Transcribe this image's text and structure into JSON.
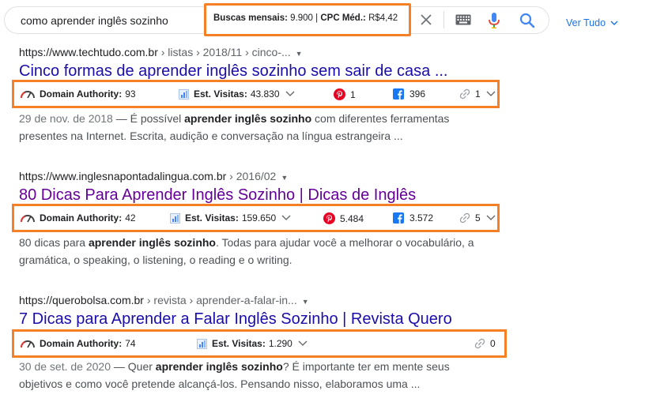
{
  "search": {
    "query": "como aprender inglês sozinho",
    "metrics": {
      "label_volume": "Buscas mensais:",
      "volume": "9.900",
      "separator": "|",
      "label_cpc": "CPC Méd.:",
      "cpc": "R$4,42"
    },
    "ver_tudo": "Ver Tudo"
  },
  "labels": {
    "domain_authority": "Domain Authority:",
    "est_visitas": "Est. Visitas:"
  },
  "colors": {
    "highlight_border": "#f58025",
    "link_blue": "#1a0dab",
    "link_visited": "#660099",
    "pinterest": "#e60023",
    "facebook": "#1877f2"
  },
  "results": [
    {
      "url_domain": "https://www.techtudo.com.br",
      "url_path": " › listas › 2018/11 › cinco-...",
      "title": "Cinco formas de aprender inglês sozinho sem sair de casa ...",
      "domain_authority": "93",
      "est_visitas": "43.830",
      "pinterest": "1",
      "facebook": "396",
      "links": "1",
      "snippet_date": "29 de nov. de 2018",
      "snippet_pre": " — É possível ",
      "snippet_bold": "aprender inglês sozinho",
      "snippet_post": " com diferentes ferramentas presentes na Internet. Escrita, audição e conversação na língua estrangeira ..."
    },
    {
      "url_domain": "https://www.inglesnapontadalingua.com.br",
      "url_path": " › 2016/02",
      "title": "80 Dicas Para Aprender Inglês Sozinho | Dicas de Inglês",
      "domain_authority": "42",
      "est_visitas": "159.650",
      "pinterest": "5.484",
      "facebook": "3.572",
      "links": "5",
      "snippet_pre": "80 dicas para ",
      "snippet_bold": "aprender inglês sozinho",
      "snippet_post": ". Todas para ajudar você a melhorar o vocabulário, a gramática, o speaking, o listening, o reading e o writing."
    },
    {
      "url_domain": "https://querobolsa.com.br",
      "url_path": " › revista › aprender-a-falar-in...",
      "title": "7 Dicas para Aprender a Falar Inglês Sozinho | Revista Quero",
      "domain_authority": "74",
      "est_visitas": "1.290",
      "links": "0",
      "snippet_date": "30 de set. de 2020",
      "snippet_pre": " — Quer ",
      "snippet_bold": "aprender inglês sozinho",
      "snippet_post": "? É importante ter em mente seus objetivos e como você pretende alcançá-los. Pensando nisso, elaboramos uma ..."
    }
  ]
}
